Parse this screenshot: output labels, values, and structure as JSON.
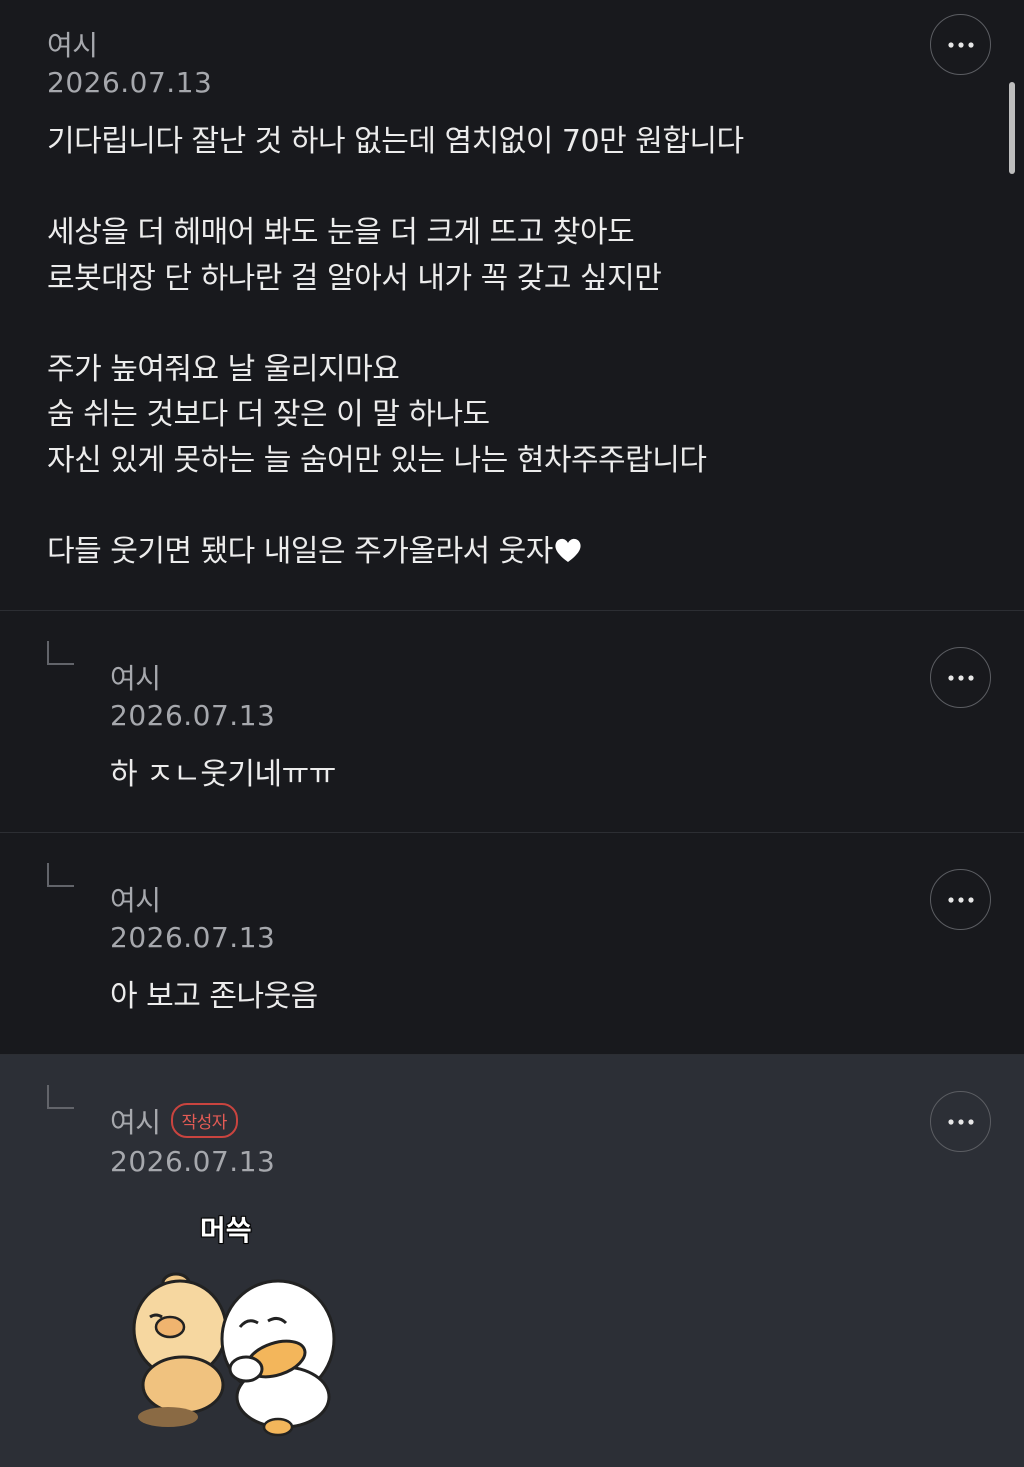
{
  "post": {
    "author": "여시",
    "date": "2026.07.13",
    "lines": [
      "기다립니다 잘난 것 하나 없는데 염치없이 70만 원합니다",
      "",
      "세상을 더 헤매어 봐도 눈을 더 크게 뜨고 찾아도",
      "로봇대장 단 하나란 걸 알아서 내가 꼭 갖고 싶지만",
      "",
      "주가 높여줘요 날 울리지마요",
      "숨 쉬는 것보다 더 잦은 이 말 하나도",
      "자신 있게 못하는  늘 숨어만 있는 나는 현차주주랍니다",
      "",
      "다들 웃기면 됐다 내일은 주가올라서 웃자"
    ],
    "more_icon": "more-horizontal-icon"
  },
  "replies": [
    {
      "author": "여시",
      "date": "2026.07.13",
      "text": "하 ㅈㄴ웃기네ㅠㅠ"
    },
    {
      "author": "여시",
      "date": "2026.07.13",
      "text": "아 보고 존나웃음"
    },
    {
      "author": "여시",
      "badge": "작성자",
      "date": "2026.07.13",
      "sticker_text": "머쓱"
    }
  ],
  "colors": {
    "background": "#18191d",
    "highlight_background": "#2c2f36",
    "badge": "#e35b55"
  }
}
